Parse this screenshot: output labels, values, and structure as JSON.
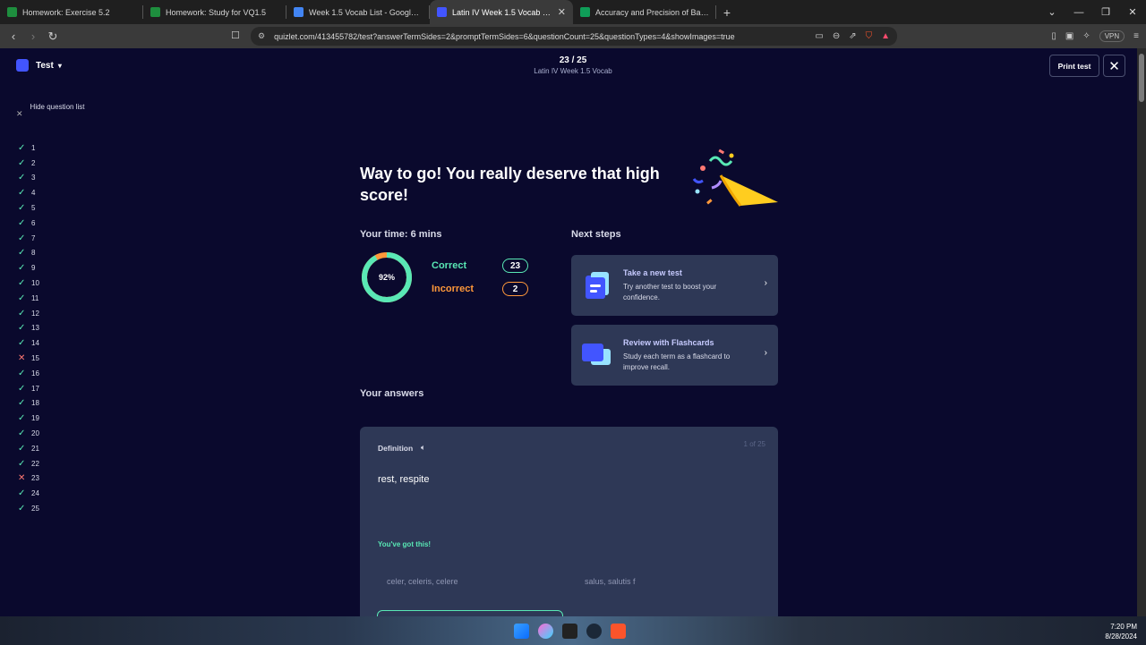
{
  "browser": {
    "tabs": [
      {
        "title": "Homework: Exercise 5.2",
        "color": "#1e8e3e",
        "active": false
      },
      {
        "title": "Homework: Study for VQ1.5",
        "color": "#1e8e3e",
        "active": false
      },
      {
        "title": "Week 1.5 Vocab List - Google Docs",
        "color": "#4285f4",
        "active": false
      },
      {
        "title": "Latin IV Week 1.5 Vocab | Quizlet",
        "color": "#4255ff",
        "active": true
      },
      {
        "title": "Accuracy and Precision of Balance P",
        "color": "#0f9d58",
        "active": false
      }
    ],
    "url": "quizlet.com/413455782/test?answerTermSides=2&promptTermSides=6&questionCount=25&questionTypes=4&showImages=true",
    "vpn_label": "VPN"
  },
  "header": {
    "mode_label": "Test",
    "progress": "23 / 25",
    "set_title": "Latin IV Week 1.5 Vocab",
    "print_label": "Print test"
  },
  "sidebar": {
    "hide_label": "Hide question list",
    "questions": [
      {
        "n": "1",
        "ok": true
      },
      {
        "n": "2",
        "ok": true
      },
      {
        "n": "3",
        "ok": true
      },
      {
        "n": "4",
        "ok": true
      },
      {
        "n": "5",
        "ok": true
      },
      {
        "n": "6",
        "ok": true
      },
      {
        "n": "7",
        "ok": true
      },
      {
        "n": "8",
        "ok": true
      },
      {
        "n": "9",
        "ok": true
      },
      {
        "n": "10",
        "ok": true
      },
      {
        "n": "11",
        "ok": true
      },
      {
        "n": "12",
        "ok": true
      },
      {
        "n": "13",
        "ok": true
      },
      {
        "n": "14",
        "ok": true
      },
      {
        "n": "15",
        "ok": false
      },
      {
        "n": "16",
        "ok": true
      },
      {
        "n": "17",
        "ok": true
      },
      {
        "n": "18",
        "ok": true
      },
      {
        "n": "19",
        "ok": true
      },
      {
        "n": "20",
        "ok": true
      },
      {
        "n": "21",
        "ok": true
      },
      {
        "n": "22",
        "ok": true
      },
      {
        "n": "23",
        "ok": false
      },
      {
        "n": "24",
        "ok": true
      },
      {
        "n": "25",
        "ok": true
      }
    ]
  },
  "results": {
    "heading": "Way to go! You really deserve that high score!",
    "time_label": "Your time: 6 mins",
    "score_percent": 92,
    "score_text": "92%",
    "correct_label": "Correct",
    "correct_count": "23",
    "incorrect_label": "Incorrect",
    "incorrect_count": "2",
    "next_steps_label": "Next steps",
    "next_steps": [
      {
        "title": "Take a new test",
        "desc": "Try another test to boost your confidence."
      },
      {
        "title": "Review with Flashcards",
        "desc": "Study each term as a flashcard to improve recall."
      }
    ]
  },
  "answers": {
    "label": "Your answers",
    "card": {
      "type_label": "Definition",
      "position": "1 of 25",
      "prompt": "rest, respite",
      "encouragement": "You've got this!",
      "options": [
        "celer, celeris, celere",
        "salus, salutis f"
      ]
    }
  },
  "taskbar": {
    "time": "7:20 PM",
    "date": "8/28/2024"
  },
  "colors": {
    "background": "#0a092d",
    "card": "#2e3856",
    "correct": "#59e8b5",
    "incorrect": "#ff983a",
    "accent": "#4255ff"
  }
}
